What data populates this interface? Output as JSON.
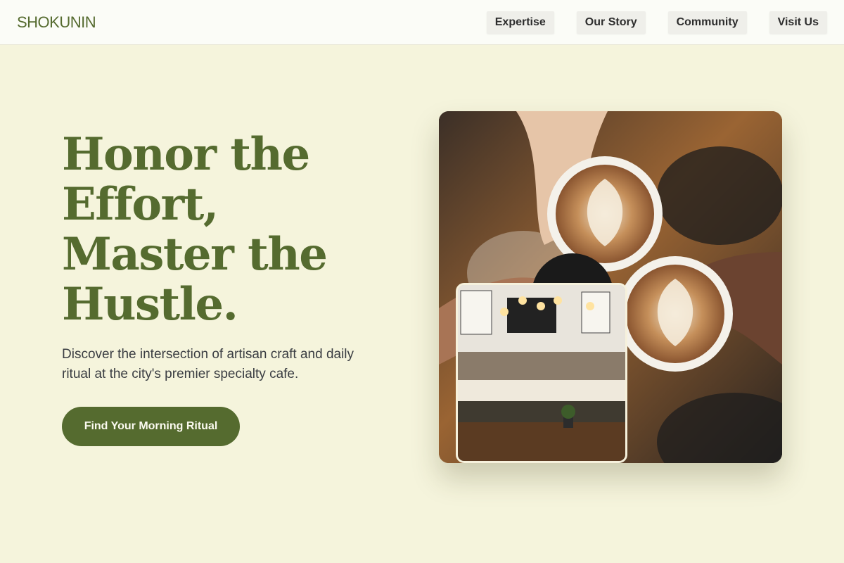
{
  "brand": {
    "name": "SHOKUNIN"
  },
  "nav": {
    "items": [
      {
        "label": "Expertise"
      },
      {
        "label": "Our Story"
      },
      {
        "label": "Community"
      },
      {
        "label": "Visit Us"
      }
    ]
  },
  "hero": {
    "headline_lines": [
      "Honor the",
      "Effort,",
      "Master the",
      "Hustle."
    ],
    "subtitle": "Discover the intersection of artisan craft and daily ritual at the city's premier specialty cafe.",
    "cta_label": "Find Your Morning Ritual"
  },
  "colors": {
    "accent": "#556b2f",
    "background": "#f5f4dc"
  }
}
